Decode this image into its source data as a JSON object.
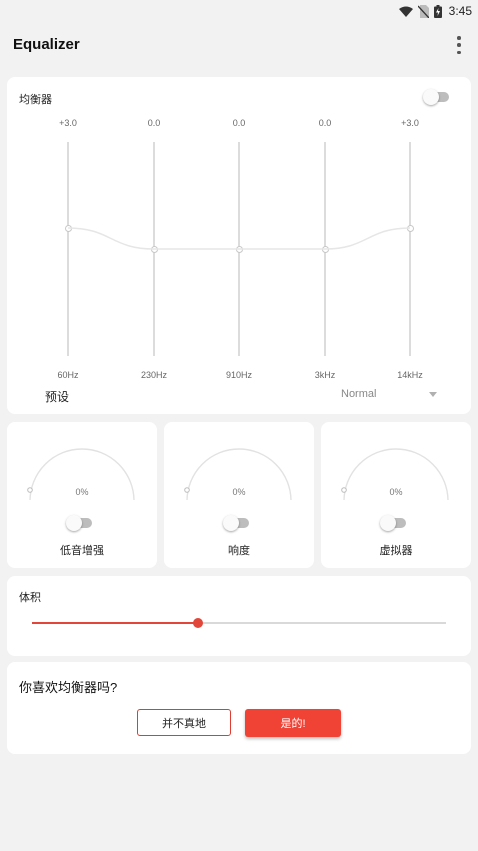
{
  "status_bar": {
    "time": "3:45"
  },
  "app_bar": {
    "title": "Equalizer"
  },
  "equalizer": {
    "label": "均衡器",
    "enabled": false,
    "bands": [
      {
        "freq": "60Hz",
        "value_label": "+3.0",
        "gain": 3.0
      },
      {
        "freq": "230Hz",
        "value_label": "0.0",
        "gain": 0.0
      },
      {
        "freq": "910Hz",
        "value_label": "0.0",
        "gain": 0.0
      },
      {
        "freq": "3kHz",
        "value_label": "0.0",
        "gain": 0.0
      },
      {
        "freq": "14kHz",
        "value_label": "+3.0",
        "gain": 3.0
      }
    ],
    "preset_label": "预设",
    "preset_value": "Normal"
  },
  "effects": [
    {
      "label": "低音增强",
      "percent": "0%",
      "enabled": false
    },
    {
      "label": "响度",
      "percent": "0%",
      "enabled": false
    },
    {
      "label": "虚拟器",
      "percent": "0%",
      "enabled": false
    }
  ],
  "volume": {
    "label": "体积",
    "level": 0.4
  },
  "feedback": {
    "question": "你喜欢均衡器吗?",
    "no_label": "并不真地",
    "yes_label": "是的!"
  },
  "colors": {
    "accent": "#e2463a",
    "button_primary": "#f04336"
  }
}
